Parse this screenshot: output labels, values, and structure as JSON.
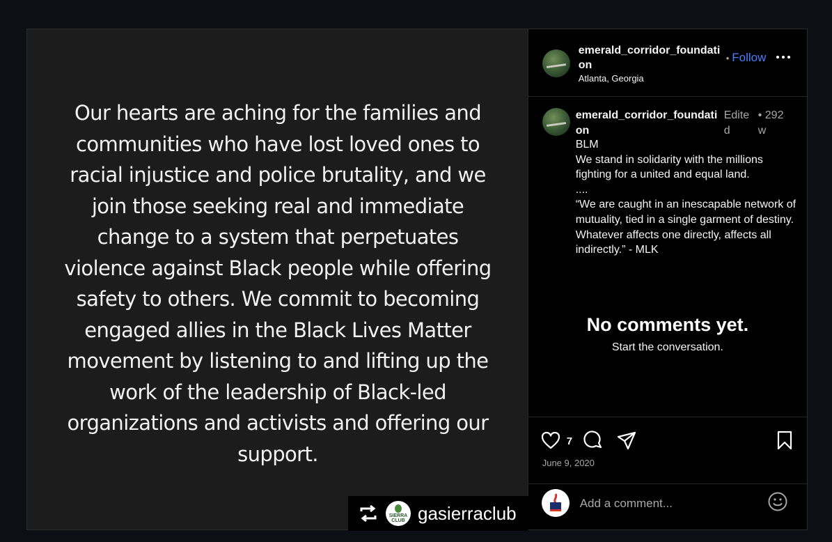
{
  "media": {
    "quote": "Our hearts are aching for the families and communities who have lost loved ones to racial injustice and police brutality, and we join those seeking real and immediate change to a system that perpetuates violence against Black people while offering safety to others. We commit to becoming engaged allies in the Black Lives Matter movement by listening to and lifting up the work of the leadership of Black-led organizations and activists and offering our support.",
    "repost_handle": "gasierraclub",
    "logo_text_1": "SIERRA",
    "logo_text_2": "CLUB"
  },
  "header": {
    "username": "emerald_corridor_foundation",
    "location": "Atlanta, Georgia",
    "separator": "•",
    "follow_label": "Follow"
  },
  "caption": {
    "username": "emerald_corridor_foundation",
    "edited_label": "Edited",
    "separator": "•",
    "time_ago": "292w",
    "lines": [
      "BLM",
      "We stand in solidarity with the millions fighting for a united and equal land.",
      "....",
      "“We are caught in an inescapable network of mutuality, tied in a single garment of destiny. Whatever affects one directly, affects all indirectly.” - MLK"
    ]
  },
  "comments": {
    "empty_title": "No comments yet.",
    "empty_subtitle": "Start the conversation."
  },
  "actions": {
    "like_count": "7",
    "date": "June 9, 2020"
  },
  "composer": {
    "placeholder": "Add a comment..."
  },
  "colors": {
    "accent": "#4a7dff",
    "background": "#0c1014",
    "media_bg": "#1c1c1c"
  },
  "icons": [
    "repost-icon",
    "more-icon",
    "heart-icon",
    "comment-icon",
    "share-icon",
    "bookmark-icon",
    "emoji-icon"
  ]
}
